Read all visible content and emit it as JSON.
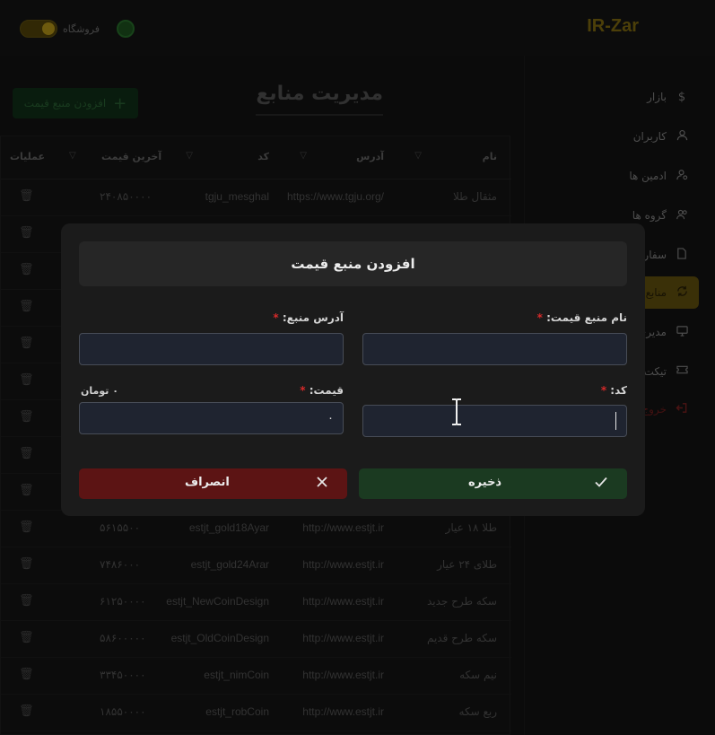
{
  "header": {
    "brand": "IR-Zar",
    "store_toggle_label": "فروشگاه",
    "store_toggle_on": true
  },
  "sidebar": {
    "items": [
      {
        "label": "بازار",
        "icon": "dollar-icon"
      },
      {
        "label": "کاربران",
        "icon": "user-icon"
      },
      {
        "label": "ادمین ها",
        "icon": "admin-icon"
      },
      {
        "label": "گروه ها",
        "icon": "group-icon"
      },
      {
        "label": "سفار",
        "icon": "document-icon"
      },
      {
        "label": "منابع",
        "icon": "refresh-icon",
        "active": true
      },
      {
        "label": "مدیری",
        "icon": "monitor-icon"
      },
      {
        "label": "تیکت",
        "icon": "ticket-icon"
      },
      {
        "label": "خروج",
        "icon": "logout-icon"
      }
    ]
  },
  "page": {
    "title": "مدیریت منابع",
    "add_button": "افزودن منبع قیمت"
  },
  "table": {
    "headers": {
      "name": "نام",
      "address": "آدرس",
      "code": "کد",
      "last_price": "آخرین قیمت",
      "actions": "عملیات"
    },
    "rows": [
      {
        "name": "مثقال طلا",
        "address": "https://www.tgju.org/",
        "code": "tgju_mesghal",
        "price": "۲۴۰۸۵۰۰۰۰"
      },
      {
        "name": "طلا ۱۸ عیار",
        "address": "http://www.estjt.ir",
        "code": "estjt_gold18Ayar",
        "price": "۵۶۱۵۵۰۰"
      },
      {
        "name": "طلای ۲۴ عیار",
        "address": "http://www.estjt.ir",
        "code": "estjt_gold24Arar",
        "price": "۷۴۸۶۰۰۰"
      },
      {
        "name": "سکه طرح جدید",
        "address": "http://www.estjt.ir",
        "code": "estjt_NewCoinDesign",
        "price": "۶۱۲۵۰۰۰۰"
      },
      {
        "name": "سکه طرح قدیم",
        "address": "http://www.estjt.ir",
        "code": "estjt_OldCoinDesign",
        "price": "۵۸۶۰۰۰۰۰"
      },
      {
        "name": "نیم سکه",
        "address": "http://www.estjt.ir",
        "code": "estjt_nimCoin",
        "price": "۳۳۴۵۰۰۰۰"
      },
      {
        "name": "ربع سکه",
        "address": "http://www.estjt.ir",
        "code": "estjt_robCoin",
        "price": "۱۸۵۵۰۰۰۰"
      }
    ]
  },
  "modal": {
    "title": "افزودن منبع قیمت",
    "name_label": "نام منبع قیمت:",
    "address_label": "آدرس منبع:",
    "code_label": "کد:",
    "price_label": "قیمت:",
    "required_mark": "*",
    "name_value": "",
    "address_value": "",
    "code_value": "",
    "price_value": "۰",
    "price_note": "۰ تومان",
    "save_label": "ذخیره",
    "cancel_label": "انصراف"
  }
}
